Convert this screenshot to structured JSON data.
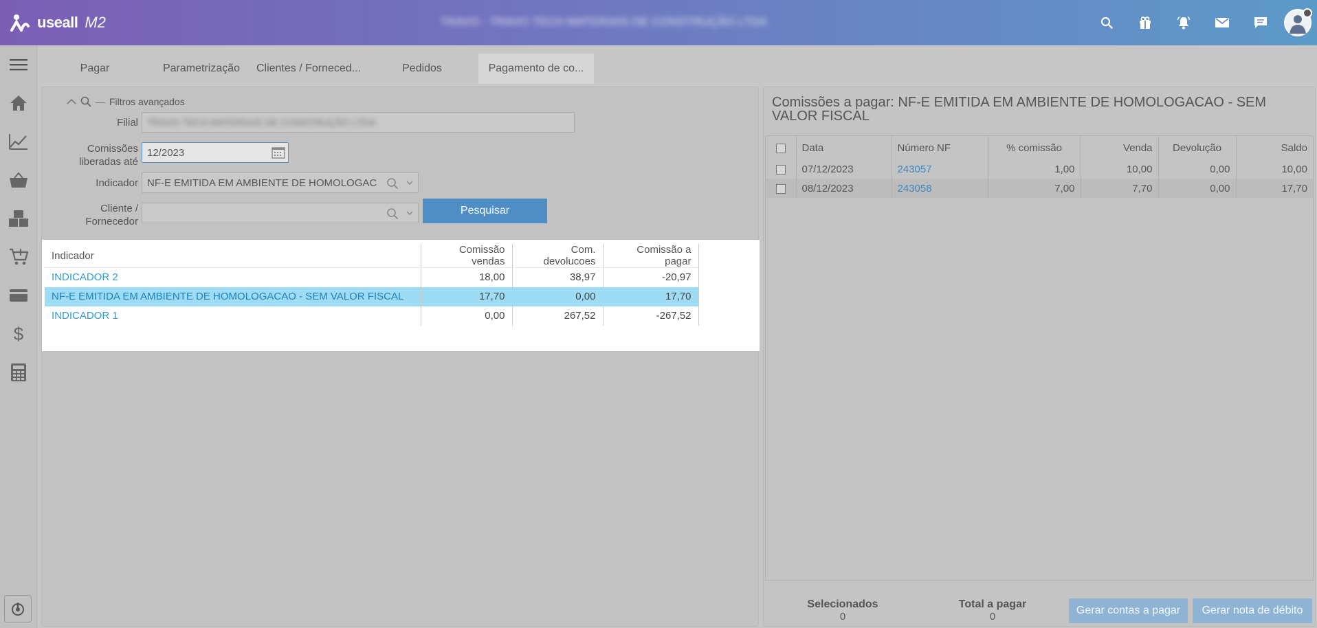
{
  "app": {
    "brand": "useall",
    "version": "M2",
    "company": "TRAVO - TRAVO TECH MATERIAIS DE CONSTRUÇÃO LTDA"
  },
  "topbar": {
    "icons": [
      "search-icon",
      "gift-icon",
      "bell-icon",
      "mail-icon",
      "chat-icon"
    ]
  },
  "sidebar": {
    "items": [
      "menu-icon",
      "home-icon",
      "chart-icon",
      "basket-icon",
      "boxes-icon",
      "cart-icon",
      "card-icon",
      "dollar-icon",
      "calculator-icon"
    ],
    "bottom": "power-icon"
  },
  "tabs": [
    "Pagar",
    "Parametrização",
    "Clientes / Forneced...",
    "Pedidos",
    "Pagamento de co..."
  ],
  "filters": {
    "title": "Filtros avançados",
    "filial_label": "Filial",
    "filial_value": "TRAVO TECH MATERIAIS DE CONSTRUÇÃO LTDA",
    "comissoes_label_1": "Comissões",
    "comissoes_label_2": "liberadas até",
    "comissoes_value": "12/2023",
    "indicador_label": "Indicador",
    "indicador_value": "NF-E EMITIDA EM AMBIENTE DE HOMOLOGAC",
    "cliente_label_1": "Cliente /",
    "cliente_label_2": "Fornecedor",
    "cliente_value": "",
    "search_button": "Pesquisar"
  },
  "indicator_table": {
    "headers": [
      "Indicador",
      "Comissão vendas",
      "Com. devolucoes",
      "Comissão a pagar"
    ],
    "rows": [
      {
        "indicador": "INDICADOR 2",
        "vendas": "18,00",
        "devolucoes": "38,97",
        "pagar": "-20,97"
      },
      {
        "indicador": "NF-E EMITIDA EM AMBIENTE DE HOMOLOGACAO - SEM VALOR FISCAL",
        "vendas": "17,70",
        "devolucoes": "0,00",
        "pagar": "17,70"
      },
      {
        "indicador": "INDICADOR 1",
        "vendas": "0,00",
        "devolucoes": "267,52",
        "pagar": "-267,52"
      }
    ]
  },
  "right_panel": {
    "title": "Comissões a pagar: NF-E EMITIDA EM AMBIENTE DE HOMOLOGACAO - SEM VALOR FISCAL",
    "headers": [
      "Data",
      "Número NF",
      "% comissão",
      "Venda",
      "Devolução",
      "Saldo"
    ],
    "rows": [
      {
        "data": "07/12/2023",
        "nf": "243057",
        "pct": "1,00",
        "venda": "10,00",
        "devolucao": "0,00",
        "saldo": "10,00"
      },
      {
        "data": "08/12/2023",
        "nf": "243058",
        "pct": "7,00",
        "venda": "7,70",
        "devolucao": "0,00",
        "saldo": "17,70"
      }
    ],
    "footer": {
      "selecionados_label": "Selecionados",
      "selecionados_value": "0",
      "total_label": "Total a pagar",
      "total_value": "0",
      "gerar_contas_button": "Gerar contas a pagar",
      "gerar_nota_button": "Gerar nota de débito"
    }
  }
}
